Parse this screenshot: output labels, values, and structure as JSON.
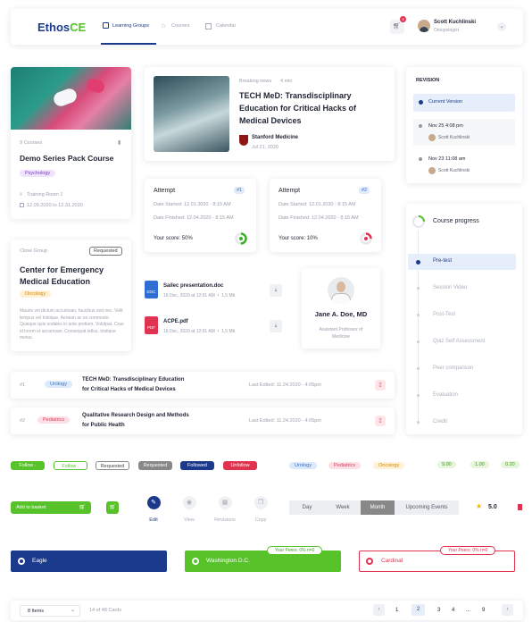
{
  "header": {
    "logo_a": "Ethos",
    "logo_b": "CE",
    "tabs": [
      {
        "label": "Learning Groups",
        "icon": "grid-icon"
      },
      {
        "label": "Courses",
        "icon": "star-icon"
      },
      {
        "label": "Calendar",
        "icon": "calendar-icon"
      }
    ],
    "cart_count": "4",
    "user_name": "Scott Kuchlinski",
    "user_role": "Omopologist"
  },
  "courseCard": {
    "count": "9 Courses",
    "title": "Demo Series Pack Course",
    "tag": "Psychology",
    "location": "Training Room 1",
    "dates": "12.09.2020 to 12.31.2020"
  },
  "groupCard": {
    "type": "Close Group",
    "status": "Requested",
    "title": "Center for Emergency Medical Education",
    "tag": "Oncology",
    "desc": "Mauris vel dictum accumsan, faucibus sed nec. Velit tempus vel tristique. Aenean ac ex commodo. Quisque quis sodales in ante pretium. Volutpat. Cras id lorem et accumsan. Consequat tellus, tristique metus."
  },
  "news": {
    "kicker": "Breaking news",
    "readtime": "4 min",
    "title": "TECH MeD: Transdisciplinary Education for Critical Hacks of Medical Devices",
    "source": "Stanford Medicine",
    "date": "Jul 21, 2020"
  },
  "attempts": [
    {
      "title": "Attempt",
      "num": "#1",
      "started": "Date Started: 12.01.2020 - 8:15 AM",
      "finished": "Date Finished: 12.04.2020 - 8:15 AM",
      "score": "Your score: 50%",
      "ring": 50,
      "color": "#3fae2a"
    },
    {
      "title": "Attempt",
      "num": "#2",
      "started": "Date Started: 12.01.2020 - 8:15 AM",
      "finished": "Date Finished: 12.04.2020 - 8:15 AM",
      "score": "Your score: 10%",
      "ring": 10,
      "color": "#e0334f"
    }
  ],
  "files": [
    {
      "type": "DOC",
      "name": "Sailec presentation.doc",
      "meta": "16 Dec, 2020 at 12:01 AM  •  1,5 Mb",
      "color": "#2f6fd3"
    },
    {
      "type": "PDF",
      "name": "ACPE.pdf",
      "meta": "16 Dec, 2020 at 12:01 AM  •  1,5 Mb",
      "color": "#e0334f"
    }
  ],
  "doctor": {
    "name": "Jane A. Doe, MD",
    "role": "Assistant Professor of Medicine"
  },
  "rows": [
    {
      "idx": "#1",
      "tag": "Urology",
      "tagBg": "#dbe9fb",
      "tagFg": "#3a72c2",
      "title1": "TECH MeD: Transdisciplinary Education",
      "title2": "for Critical Hacks of Medical Devices",
      "edited": "Last Edited: 11.24.2020 - 4:05pm"
    },
    {
      "idx": "#2",
      "tag": "Pediatrics",
      "tagBg": "#fde0e6",
      "tagFg": "#d63a5b",
      "title1": "Qualitative Research Design and Methods",
      "title2": "for Public Health",
      "edited": "Last Edited: 11.24.2020 - 4:05pm"
    }
  ],
  "revision": {
    "title": "REVISION",
    "current": "Current Version",
    "items": [
      {
        "date": "Nov 25 4:08 pm",
        "user": "Scott Kuchlinski"
      },
      {
        "date": "Nov 23 11:08 am",
        "user": "Scott Kuchlinski"
      }
    ]
  },
  "progress": {
    "title": "Course progress",
    "steps": [
      "Pre-test",
      "Session Video",
      "Post-Test",
      "Quiz Self Assessment",
      "Peer comparison",
      "Evaluation",
      "Credit"
    ]
  },
  "buttons": {
    "follow1": "Follow",
    "follow2": "Follow",
    "requested1": "Requested",
    "requested2": "Requested",
    "followed": "Followed",
    "unfollow": "Unfollow"
  },
  "tags": {
    "urology": "Urology",
    "pediatrics": "Pediatrics",
    "oncology": "Oncology",
    "s1": "9.00",
    "s2": "1.00",
    "s3": "0.20"
  },
  "actions": {
    "basket": "Add to basket",
    "edit": "Edit",
    "view": "View",
    "revisions": "Revisions",
    "copy": "Copy"
  },
  "segment": [
    "Day",
    "Week",
    "Month",
    "Upcoming Events"
  ],
  "rating": "5.0",
  "radios": [
    {
      "label": "Eagle"
    },
    {
      "label": "Washington D.C.",
      "peers": "Your Peers: 0% n=0"
    },
    {
      "label": "Cardinal",
      "peers": "Your Peers: 0% n=0"
    }
  ],
  "footer": {
    "items": "8 Items",
    "cards": "14 of 48 Cards",
    "pages": [
      "1",
      "2",
      "3",
      "4",
      "...",
      "9"
    ]
  }
}
